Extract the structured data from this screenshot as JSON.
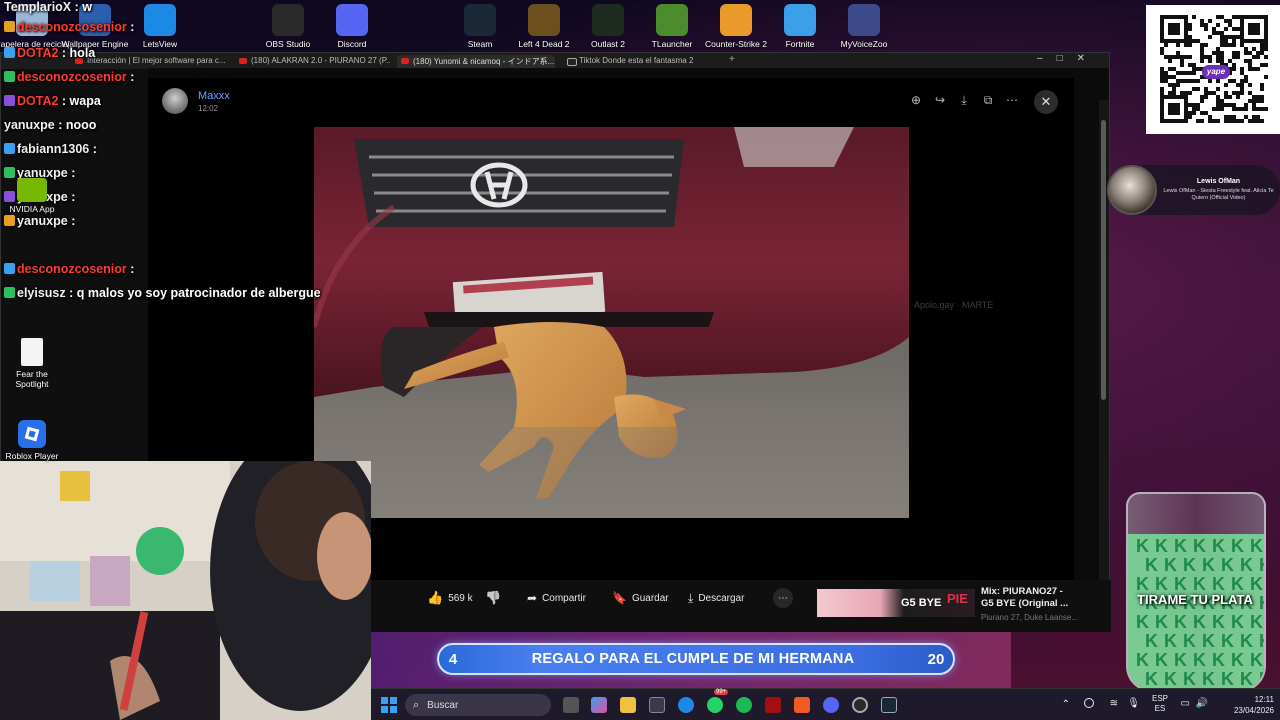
{
  "desktop": {
    "top_icons": [
      {
        "label": "Papelera de reciclaje",
        "icon": "recycle-bin-icon",
        "color": "#9ab7d8"
      },
      {
        "label": "Wallpaper Engine",
        "icon": "wallpaper-engine-icon",
        "color": "#2b5fae"
      },
      {
        "label": "LetsView",
        "icon": "letsview-icon",
        "color": "#1e88e5"
      },
      {
        "label": "OBS Studio",
        "icon": "obs-icon",
        "color": "#2a2a2a"
      },
      {
        "label": "Discord",
        "icon": "discord-icon",
        "color": "#5865f2"
      },
      {
        "label": "Steam",
        "icon": "steam-icon",
        "color": "#1b2838"
      },
      {
        "label": "Left 4 Dead 2",
        "icon": "left4dead-icon",
        "color": "#6b4f1d"
      },
      {
        "label": "Outlast 2",
        "icon": "outlast-icon",
        "color": "#1f2b20"
      },
      {
        "label": "TLauncher",
        "icon": "tlauncher-icon",
        "color": "#4c8c2b"
      },
      {
        "label": "Counter-Strike 2",
        "icon": "cs2-icon",
        "color": "#e89a2a"
      },
      {
        "label": "Fortnite",
        "icon": "fortnite-icon",
        "color": "#3aa0e8"
      },
      {
        "label": "MyVoiceZoo",
        "icon": "myvoicezoo-icon",
        "color": "#3c4a8a"
      }
    ],
    "left_icons": [
      {
        "label": "NVIDIA App",
        "icon": "nvidia-icon"
      },
      {
        "label": "Fear the Spotlight",
        "icon": "file-icon"
      },
      {
        "label": "Roblox Player",
        "icon": "roblox-icon"
      }
    ]
  },
  "chat": [
    {
      "user": "TemplarioX",
      "msg": "w",
      "red": false
    },
    {
      "user": "desconozcosenior",
      "msg": "",
      "red": true
    },
    {
      "user": "DOTA2",
      "msg": "hola",
      "red": true
    },
    {
      "user": "desconozcosenior",
      "msg": "",
      "red": true
    },
    {
      "user": "DOTA2",
      "msg": "wapa",
      "red": true
    },
    {
      "user": "yanuxpe",
      "msg": "nooo",
      "red": false
    },
    {
      "user": "fabiann1306",
      "msg": "",
      "red": false
    },
    {
      "user": "yanuxpe",
      "msg": "",
      "red": false
    },
    {
      "user": "yanuxpe",
      "msg": "",
      "red": false
    },
    {
      "user": "yanuxpe",
      "msg": "",
      "red": false
    },
    {
      "user": "desconozcosenior",
      "msg": "",
      "red": true
    },
    {
      "user": "elyisusz",
      "msg": "q malos yo soy patrocinador de albergue",
      "red": false
    }
  ],
  "browser": {
    "tabs": [
      "Interacción | El mejor software para c...",
      "(180) ALAKRAN 2.0 - PIURANO 27 (P...",
      "(180) Yunomi & nicamoq - インドア系...",
      "Tiktok Donde esta el fantasma 2"
    ]
  },
  "viewer": {
    "author": "Maxxx",
    "time": "12:02"
  },
  "video_actions": {
    "likes": "569 k",
    "share": "Compartir",
    "save": "Guardar",
    "download": "Descargar",
    "more": "⋯"
  },
  "mix": {
    "title_line1": "Mix: PIURANO27 -",
    "title_line2": "G5 BYE (Original ...",
    "sub": "Piurano 27, Duke Laanse...",
    "thumb_text": "G5 BYE"
  },
  "banner": {
    "left": "4",
    "text": "REGALO PARA EL CUMPLE DE MI HERMANA",
    "right": "20",
    "progress": 0.2
  },
  "now_playing": {
    "artist": "Lewis OfMan",
    "track": "Lewis OfMan - Siesta Freestyle feat. Alicia Te Quiero (Official Video)"
  },
  "qr": {
    "brand": "yape"
  },
  "jar": {
    "text": "TIRAME TU PLATA"
  },
  "taskbar": {
    "search": "Buscar",
    "lang1": "ESP",
    "lang2": "ES",
    "time": "12:11",
    "date": "23/04/2026",
    "badge": "99+"
  }
}
